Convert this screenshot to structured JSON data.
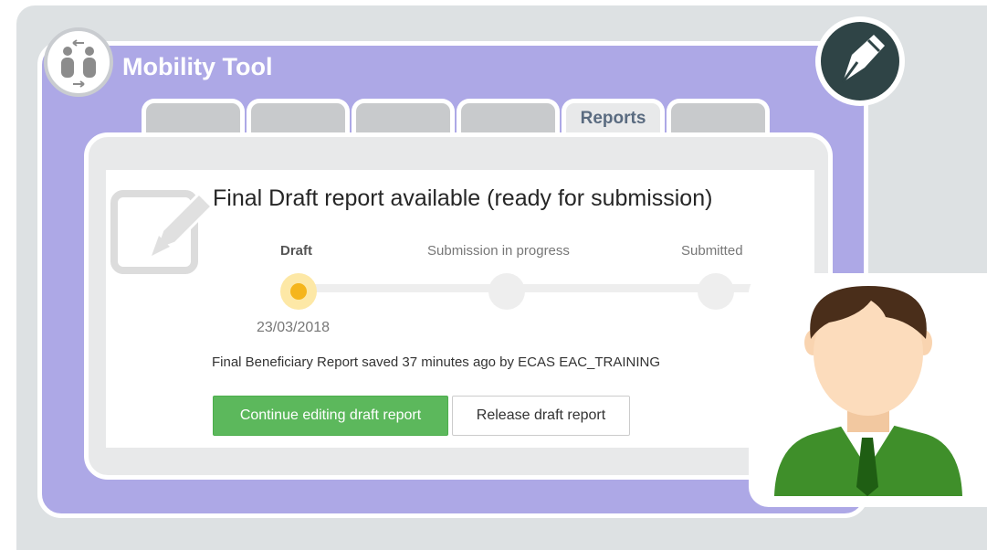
{
  "app": {
    "title": "Mobility Tool"
  },
  "tabs": [
    {
      "label": ""
    },
    {
      "label": ""
    },
    {
      "label": ""
    },
    {
      "label": ""
    },
    {
      "label": "Reports"
    },
    {
      "label": ""
    }
  ],
  "report": {
    "heading": "Final Draft report available (ready for submission)",
    "steps": [
      {
        "label": "Draft",
        "date": "23/03/2018",
        "state": "current"
      },
      {
        "label": "Submission in progress",
        "state": "pending"
      },
      {
        "label": "Submitted",
        "state": "pending"
      }
    ],
    "status_text": "Final Beneficiary Report saved 37 minutes ago by ECAS EAC_TRAINING",
    "continue_label": "Continue editing draft report",
    "release_label": "Release draft report"
  },
  "colors": {
    "window_bg": "#ada8e6",
    "frame_bg": "#dde1e3",
    "primary_button": "#5cb85c",
    "current_step": "#f5b51b",
    "badge_bg": "#2f4446",
    "suit": "#3f8f2a"
  },
  "icons": {
    "logo": "mobility-people-icon",
    "badge": "pen-nib-icon",
    "document": "edit-document-icon",
    "avatar": "user-avatar-icon"
  }
}
